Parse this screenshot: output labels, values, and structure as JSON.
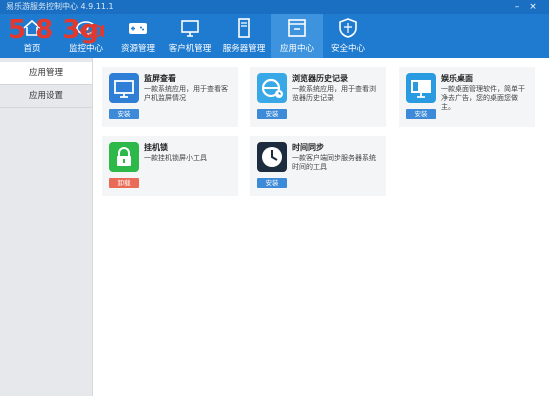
{
  "window": {
    "title": "易乐游服务控制中心 4.9.11.1"
  },
  "watermark": {
    "text": "5 8 3go",
    "sub": "com"
  },
  "nav": [
    {
      "label": "首页",
      "icon": "home-icon"
    },
    {
      "label": "监控中心",
      "icon": "eye-icon"
    },
    {
      "label": "资源管理",
      "icon": "gamepad-icon"
    },
    {
      "label": "客户机管理",
      "icon": "monitor-icon"
    },
    {
      "label": "服务器管理",
      "icon": "server-icon"
    },
    {
      "label": "应用中心",
      "icon": "app-center-icon"
    },
    {
      "label": "安全中心",
      "icon": "shield-icon"
    }
  ],
  "sidebar": {
    "items": [
      {
        "label": "应用管理"
      },
      {
        "label": "应用设置"
      }
    ]
  },
  "apps": [
    {
      "name": "监屏查看",
      "desc": "一款系统应用，用于查看客户机监屏情况",
      "action": "安装",
      "icon": "monitor-icon",
      "color": "#2f7fd6"
    },
    {
      "name": "浏览器历史记录",
      "desc": "一款系统应用，用于查看浏览器历史记录",
      "action": "安装",
      "icon": "browser-history-icon",
      "color": "#39a8e6"
    },
    {
      "name": "娱乐桌面",
      "desc": "一款桌面管理软件，简单干净去广告，您的桌面您做主。",
      "action": "安装",
      "icon": "desktop-icon",
      "color": "#2a9be0"
    },
    {
      "name": "挂机锁",
      "desc": "一款挂机锁屏小工具",
      "action": "卸载",
      "icon": "lock-icon",
      "color": "#2db84a"
    },
    {
      "name": "时间同步",
      "desc": "一款客户端同步服务器系统时间的工具",
      "action": "安装",
      "icon": "clock-icon",
      "color": "#1d2b3f"
    }
  ]
}
